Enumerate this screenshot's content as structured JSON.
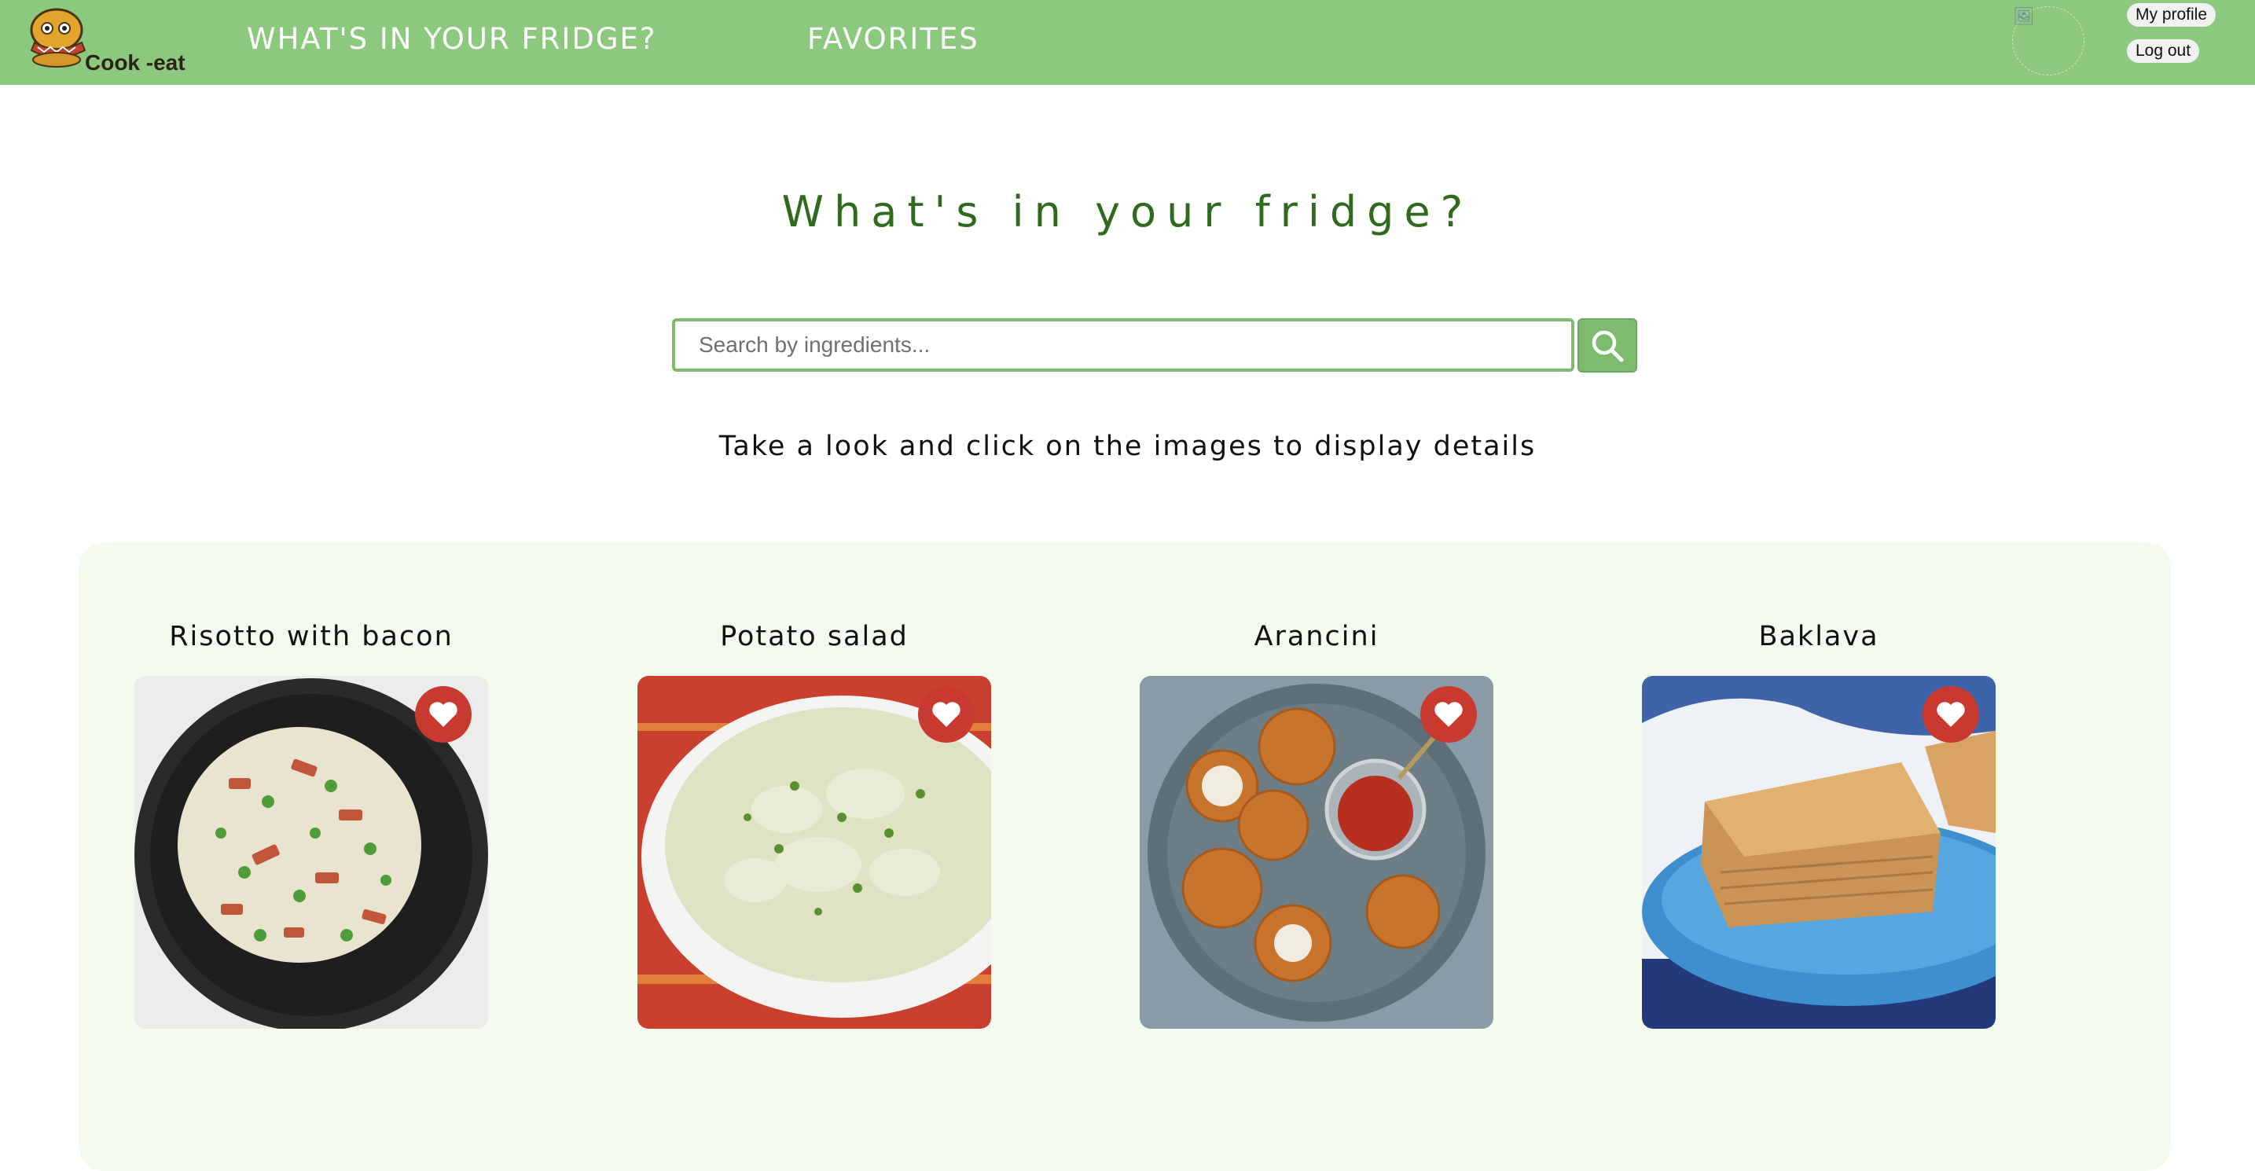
{
  "nav": {
    "brand": "Cook -eat",
    "links": [
      "WHAT'S IN YOUR FRIDGE?",
      "FAVORITES"
    ],
    "user_buttons": [
      "My profile",
      "Log out"
    ]
  },
  "hero": {
    "title": "What's in your fridge?",
    "search_placeholder": "Search by ingredients...",
    "subtitle": "Take a look and click on the images to display details"
  },
  "recipes": [
    {
      "name": "Risotto with bacon",
      "favorite_icon": "heart-icon"
    },
    {
      "name": "Potato salad",
      "favorite_icon": "heart-icon"
    },
    {
      "name": "Arancini",
      "favorite_icon": "heart-icon"
    },
    {
      "name": "Baklava",
      "favorite_icon": "heart-icon"
    }
  ],
  "colors": {
    "navbar": "#8cc87d",
    "title": "#2f6a1e",
    "accent": "#7fbb6f",
    "panel": "#f3fbef",
    "favorite": "#c8392f"
  }
}
